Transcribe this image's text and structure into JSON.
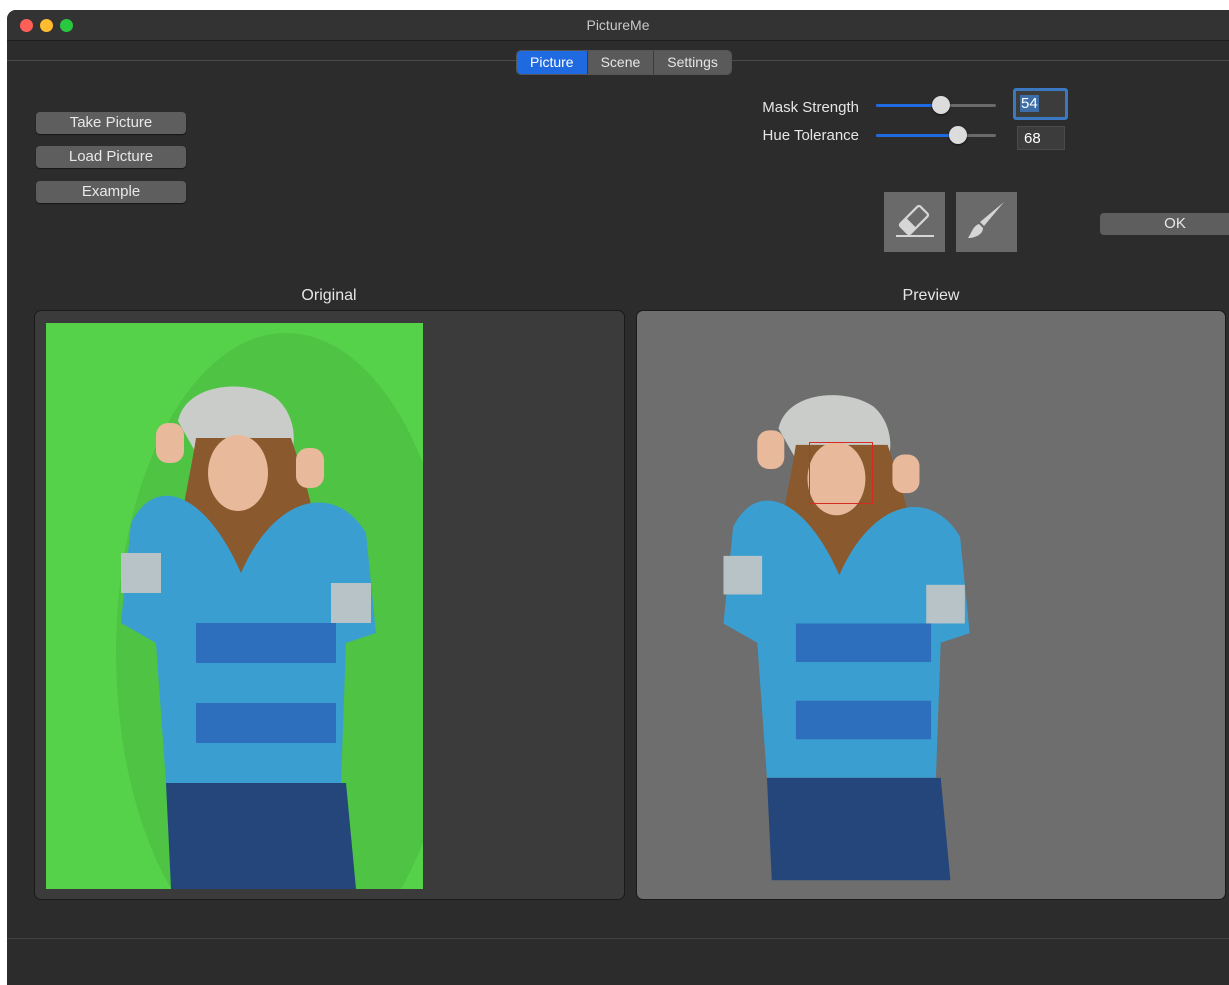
{
  "window": {
    "title": "PictureMe"
  },
  "tabs": [
    {
      "label": "Picture",
      "active": true
    },
    {
      "label": "Scene",
      "active": false
    },
    {
      "label": "Settings",
      "active": false
    }
  ],
  "actions": {
    "take_picture": "Take Picture",
    "load_picture": "Load Picture",
    "example": "Example"
  },
  "sliders": {
    "mask_strength": {
      "label": "Mask Strength",
      "value": "54",
      "fraction": 0.54
    },
    "hue_tolerance": {
      "label": "Hue Tolerance",
      "value": "68",
      "fraction": 0.68
    }
  },
  "tools": {
    "eraser": "eraser-icon",
    "brush": "brush-icon"
  },
  "ok_button": "OK",
  "panels": {
    "original_label": "Original",
    "preview_label": "Preview"
  },
  "colors": {
    "accent": "#1f6ae0",
    "green_screen": "#56d14a",
    "preview_background": "#6e6e6e",
    "face_box": "#d62b22"
  }
}
